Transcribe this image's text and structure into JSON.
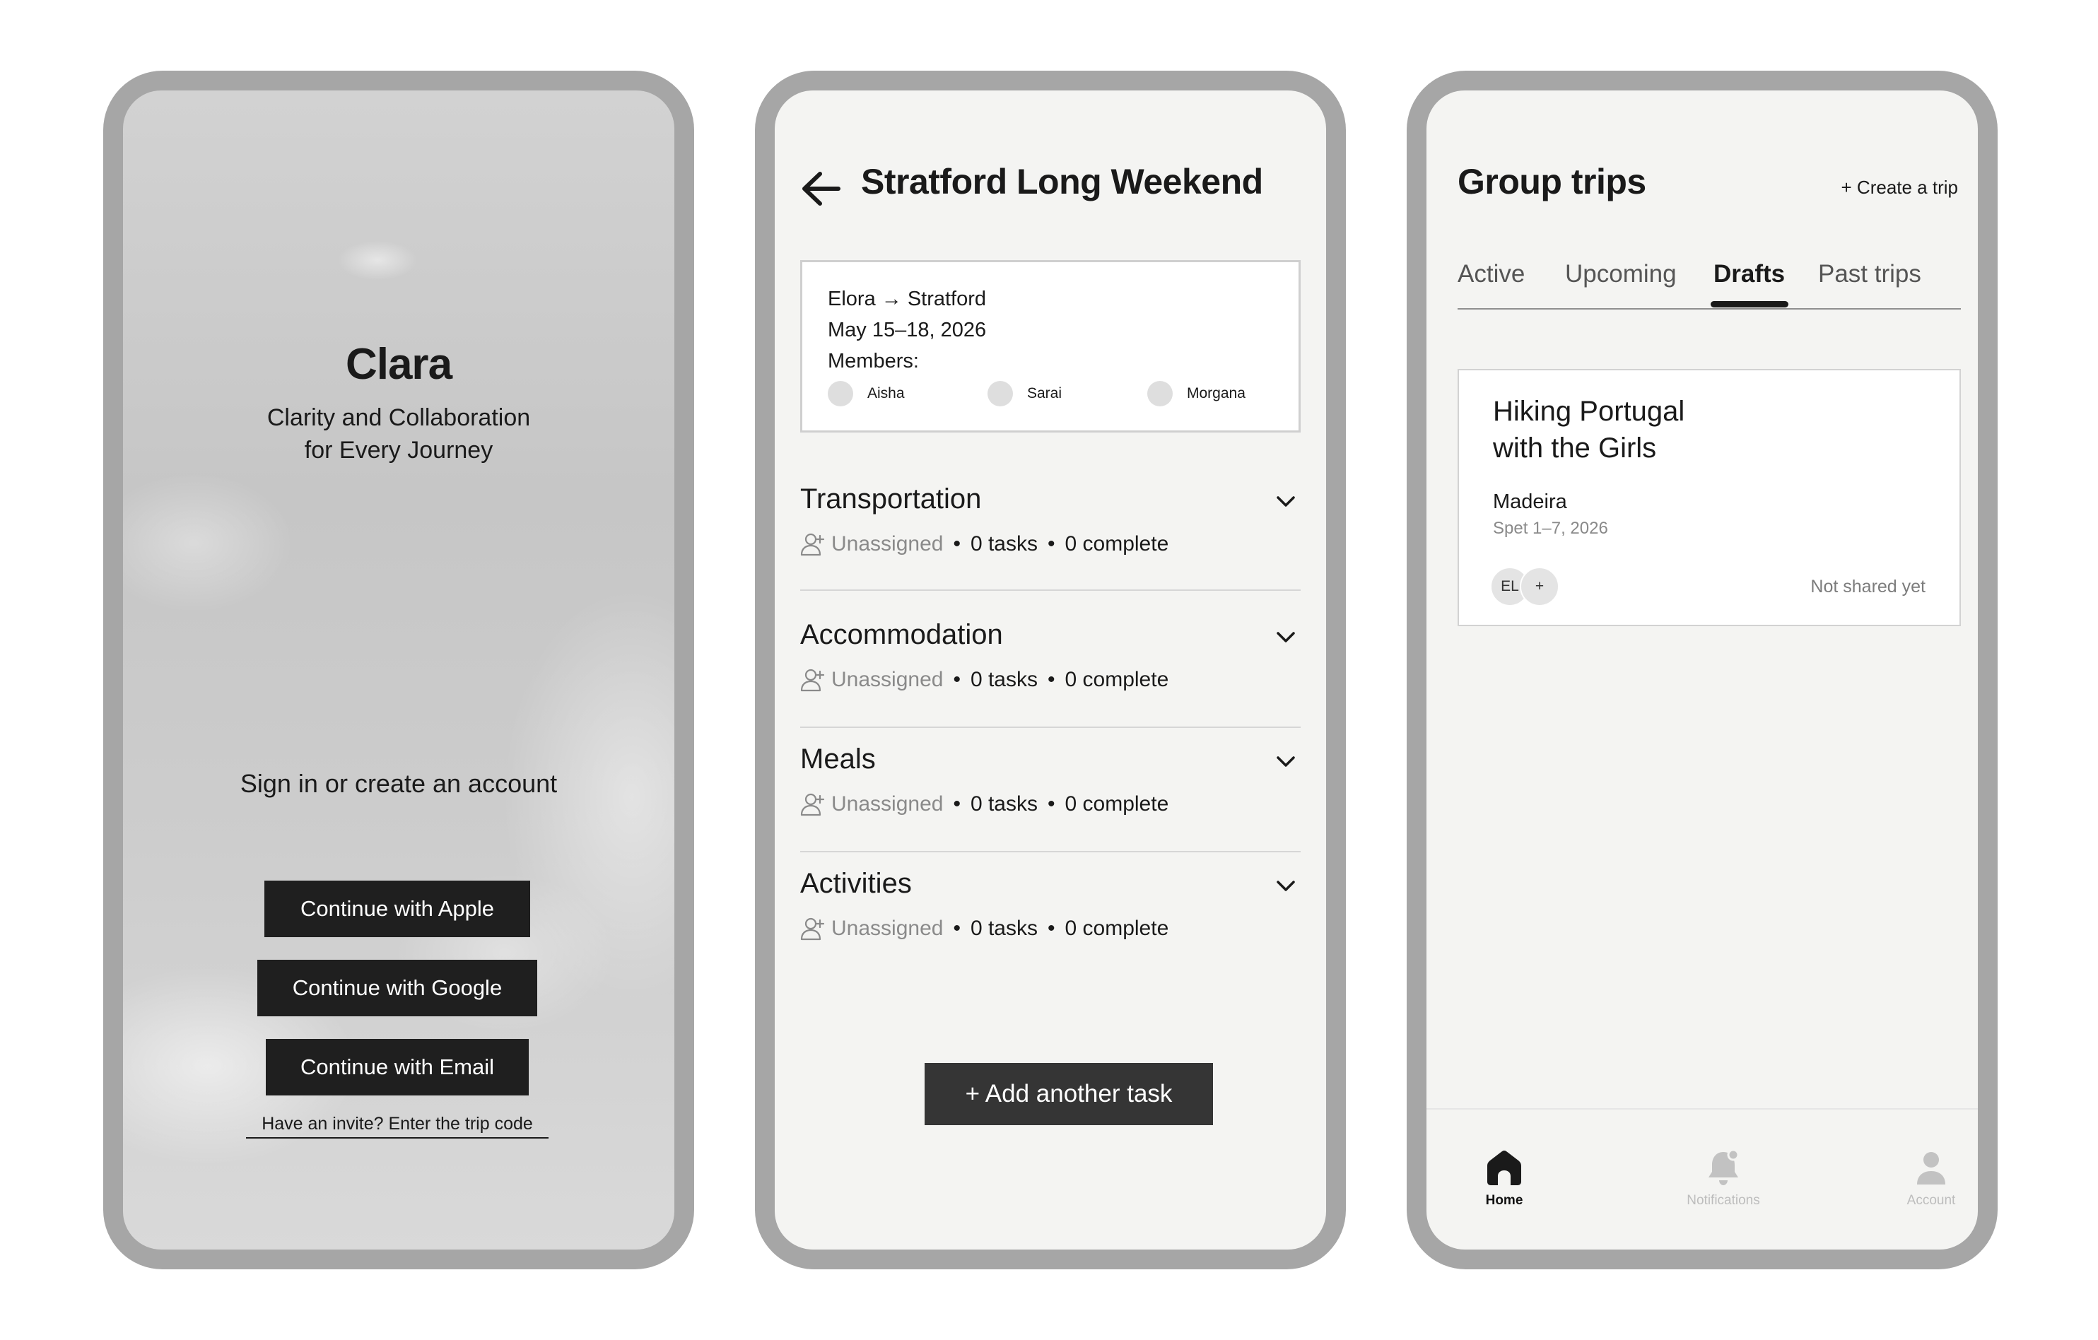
{
  "signin_screen": {
    "app_name": "Clara",
    "tagline_line1": "Clarity and Collaboration",
    "tagline_line2": "for Every Journey",
    "prompt": "Sign in or create an account",
    "apple_button": "Continue with Apple",
    "google_button": "Continue with Google",
    "email_button": "Continue with Email",
    "invite_link": "Have an invite? Enter the trip code"
  },
  "trip_screen": {
    "title": "Stratford Long Weekend",
    "route": "Elora → Stratford",
    "dates": "May 15–18, 2026",
    "members_label": "Members:",
    "members": [
      "Aisha",
      "Sarai",
      "Morgana"
    ],
    "sections": [
      {
        "title": "Transportation",
        "assignee": "Unassigned",
        "tasks": "0 tasks",
        "complete": "0 complete"
      },
      {
        "title": "Accommodation",
        "assignee": "Unassigned",
        "tasks": "0 tasks",
        "complete": "0 complete"
      },
      {
        "title": "Meals",
        "assignee": "Unassigned",
        "tasks": "0 tasks",
        "complete": "0 complete"
      },
      {
        "title": "Activities",
        "assignee": "Unassigned",
        "tasks": "0 tasks",
        "complete": "0 complete"
      }
    ],
    "bullet": "•",
    "add_task_button": "+ Add another task"
  },
  "group_trips_screen": {
    "title": "Group trips",
    "create_trip": "+ Create a trip",
    "tabs": [
      "Active",
      "Upcoming",
      "Drafts",
      "Past trips"
    ],
    "active_tab": "Drafts",
    "draft": {
      "title_line1": "Hiking Portugal",
      "title_line2": "with the Girls",
      "place": "Madeira",
      "dates": "Spet 1–7, 2026",
      "avatar_initials": "EL",
      "add_member": "+",
      "status": "Not shared yet"
    },
    "nav": [
      {
        "label": "Home",
        "icon": "home-icon",
        "active": true
      },
      {
        "label": "Notifications",
        "icon": "bell-icon",
        "active": false
      },
      {
        "label": "Account",
        "icon": "person-icon",
        "active": false
      }
    ]
  },
  "colors": {
    "phone_frame": "#a6a6a6",
    "screen_bg": "#f4f4f2",
    "primary_button": "#1f1f1f",
    "muted_text": "#8a8a8a"
  }
}
